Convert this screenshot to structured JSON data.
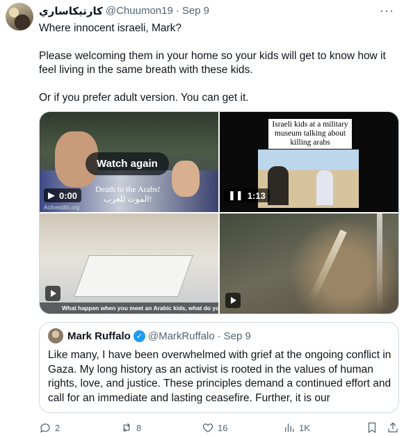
{
  "tweet": {
    "display_name": "كارتيكاساري",
    "handle": "@Chuumon19",
    "separator": "·",
    "date": "Sep 9",
    "more_icon": "more-icon",
    "paragraphs": [
      "Where innocent israeli, Mark?",
      "Please welcoming them in your home so your kids will get to know how it feel living in the same breath with these kids.",
      "Or if you prefer adult version. You can get it."
    ]
  },
  "media": {
    "tile1": {
      "overlay_button": "Watch again",
      "subtitle_en": "Death to the Arabs!",
      "subtitle_ar": "الموت للعرب!",
      "watermark": "Activestills.org",
      "time": "0:00",
      "state_icon": "play-icon"
    },
    "tile2": {
      "caption": "Israeli kids at a military museum talking about killing arabs",
      "time": "1:13",
      "state_icon": "pause-icon"
    },
    "tile3": {
      "caption": "What happen when you meet an Arabic kids, what do you feel?",
      "state_icon": "play-icon"
    },
    "tile4": {
      "state_icon": "play-icon"
    }
  },
  "quote": {
    "display_name": "Mark Ruffalo",
    "verified_icon": "verified-badge-icon",
    "handle": "@MarkRuffalo",
    "separator": "·",
    "date": "Sep 9",
    "text": "Like many, I have been overwhelmed with grief at the ongoing conflict in Gaza. My long history as an activist is rooted in the values of human rights, love, and justice. These principles demand a continued effort and call for an immediate and lasting ceasefire. Further, it is our"
  },
  "actions": {
    "replies": "2",
    "reposts": "8",
    "likes": "16",
    "views": "1K"
  },
  "colors": {
    "text_primary": "#0f1419",
    "text_secondary": "#536471",
    "border": "#cfd9de",
    "verified": "#1d9bf0"
  }
}
